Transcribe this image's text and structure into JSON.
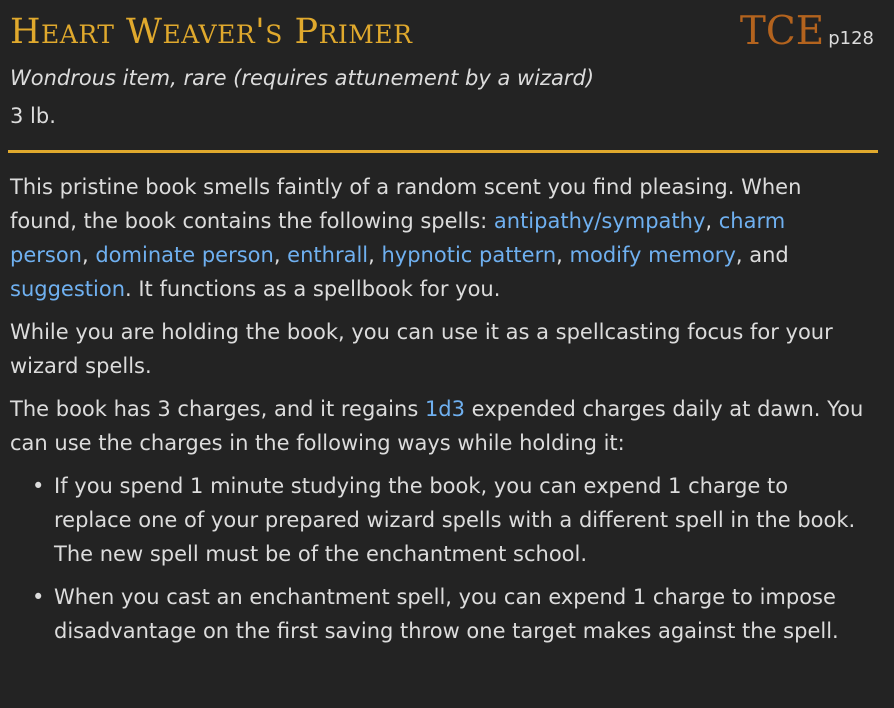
{
  "item": {
    "name": "Heart Weaver's Primer",
    "source_abbr": "TCE",
    "source_page": "p128",
    "type_line": "Wondrous item, rare (requires attunement by a wizard)",
    "weight": "3 lb."
  },
  "colors": {
    "background": "#232323",
    "title": "#e0a92d",
    "source": "#b3631e",
    "link": "#6fb0f0",
    "text": "#dcdcdc"
  },
  "description": {
    "p1": {
      "t1": "This pristine book smells faintly of a random scent you find pleasing. When found, the book contains the following spells: ",
      "spells": [
        "antipathy/sympathy",
        "charm person",
        "dominate person",
        "enthrall",
        "hypnotic pattern",
        "modify memory",
        "suggestion"
      ],
      "sep": ", ",
      "sep_and": ", and ",
      "t_end": ". It functions as a spellbook for you."
    },
    "p2": "While you are holding the book, you can use it as a spellcasting focus for your wizard spells.",
    "p3": {
      "t1": "The book has 3 charges, and it regains ",
      "dice": "1d3",
      "t2": " expended charges daily at dawn. You can use the charges in the following ways while holding it:"
    },
    "bullets": [
      "If you spend 1 minute studying the book, you can expend 1 charge to replace one of your prepared wizard spells with a different spell in the book. The new spell must be of the enchantment school.",
      "When you cast an enchantment spell, you can expend 1 charge to impose disadvantage on the first saving throw one target makes against the spell."
    ],
    "bullet_symbol": "•"
  }
}
